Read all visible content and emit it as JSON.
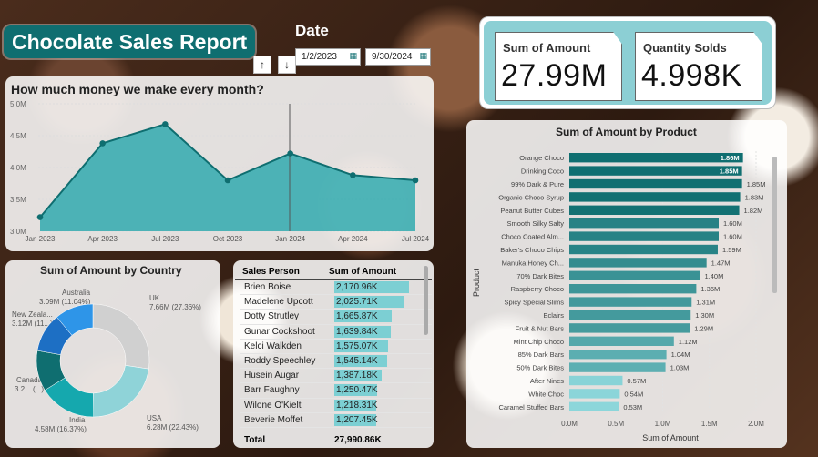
{
  "report": {
    "title": "Chocolate Sales Report"
  },
  "date_filter": {
    "title": "Date",
    "start": "1/2/2023",
    "end": "9/30/2024"
  },
  "kpis": [
    {
      "label": "Sum of Amount",
      "value": "27.99M"
    },
    {
      "label": "Quantity Solds",
      "value": "4.998K"
    }
  ],
  "colors": {
    "teal": "#0f6e70",
    "teal_mid": "#1aa3a8",
    "teal_light": "#7ccfd3",
    "kpi_bg": "#8ccfd4"
  },
  "monthly": {
    "title": "How much money we make every month?",
    "y_ticks": [
      "5.0M",
      "4.5M",
      "4.0M",
      "3.5M",
      "3.0M"
    ],
    "x_ticks": [
      "Jan 2023",
      "Apr 2023",
      "Jul 2023",
      "Oct 2023",
      "Jan 2024",
      "Apr 2024",
      "Jul 2024"
    ]
  },
  "country": {
    "title": "Sum of Amount by Country",
    "labels": [
      "UK",
      "7.66M (27.36%)",
      "USA",
      "6.28M (22.43%)",
      "India",
      "4.58M (16.37%)",
      "Canada",
      "3.2... (...)",
      "New Zeala...",
      "3.12M (11...)",
      "Australia",
      "3.09M (11.04%)"
    ]
  },
  "sales_table": {
    "headers": [
      "Sales Person",
      "Sum of Amount"
    ],
    "rows": [
      {
        "name": "Brien Boise",
        "amount": "2,170.96K"
      },
      {
        "name": "Madelene Upcott",
        "amount": "2,025.71K"
      },
      {
        "name": "Dotty Strutley",
        "amount": "1,665.87K"
      },
      {
        "name": "Gunar Cockshoot",
        "amount": "1,639.84K"
      },
      {
        "name": "Kelci Walkden",
        "amount": "1,575.07K"
      },
      {
        "name": "Roddy Speechley",
        "amount": "1,545.14K"
      },
      {
        "name": "Husein Augar",
        "amount": "1,387.18K"
      },
      {
        "name": "Barr Faughny",
        "amount": "1,250.47K"
      },
      {
        "name": "Wilone O'Kielt",
        "amount": "1,218.31K"
      },
      {
        "name": "Beverie Moffet",
        "amount": "1,207.45K"
      }
    ],
    "total_label": "Total",
    "total_value": "27,990.86K"
  },
  "chart_data": [
    {
      "type": "area",
      "title": "How much money we make every month?",
      "x": [
        "Jan 2023",
        "Apr 2023",
        "Jul 2023",
        "Oct 2023",
        "Jan 2024",
        "Apr 2024",
        "Jul 2024"
      ],
      "series": [
        {
          "values": [
            3.22,
            4.38,
            4.68,
            3.8,
            4.22,
            3.88,
            3.8
          ]
        }
      ],
      "ylim": [
        3.0,
        5.0
      ],
      "x_index_range": [
        0,
        18.2
      ]
    },
    {
      "type": "pie",
      "title": "Sum of Amount by Country",
      "slices": [
        {
          "name": "UK",
          "value": 7.66,
          "pct": 27.36
        },
        {
          "name": "USA",
          "value": 6.28,
          "pct": 22.43
        },
        {
          "name": "India",
          "value": 4.58,
          "pct": 16.37
        },
        {
          "name": "Canada",
          "value": 3.25,
          "pct": 11.6
        },
        {
          "name": "New Zealand",
          "value": 3.12,
          "pct": 11.15
        },
        {
          "name": "Australia",
          "value": 3.09,
          "pct": 11.04
        }
      ]
    },
    {
      "type": "bar",
      "title": "Sum of Amount by Product",
      "xlabel": "Sum of Amount",
      "ylabel": "Product",
      "xlim": [
        0,
        2.0
      ],
      "x_ticks": [
        "0.0M",
        "0.5M",
        "1.0M",
        "1.5M",
        "2.0M"
      ],
      "categories": [
        "Orange Choco",
        "Drinking Coco",
        "99% Dark & Pure",
        "Organic Choco Syrup",
        "Peanut Butter Cubes",
        "Smooth Silky Salty",
        "Choco Coated Alm...",
        "Baker's Choco Chips",
        "Manuka Honey Ch...",
        "70% Dark Bites",
        "Raspberry Choco",
        "Spicy Special Slims",
        "Eclairs",
        "Fruit & Nut Bars",
        "Mint Chip Choco",
        "85% Dark Bars",
        "50% Dark Bites",
        "After Nines",
        "White Choc",
        "Caramel Stuffed Bars"
      ],
      "values": [
        1.86,
        1.85,
        1.85,
        1.83,
        1.82,
        1.6,
        1.6,
        1.59,
        1.47,
        1.4,
        1.36,
        1.31,
        1.3,
        1.29,
        1.12,
        1.04,
        1.03,
        0.57,
        0.54,
        0.53
      ],
      "labels": [
        "1.86M",
        "1.85M",
        "1.85M",
        "1.83M",
        "1.82M",
        "1.60M",
        "1.60M",
        "1.59M",
        "1.47M",
        "1.40M",
        "1.36M",
        "1.31M",
        "1.30M",
        "1.29M",
        "1.12M",
        "1.04M",
        "1.03M",
        "0.57M",
        "0.54M",
        "0.53M"
      ]
    }
  ]
}
